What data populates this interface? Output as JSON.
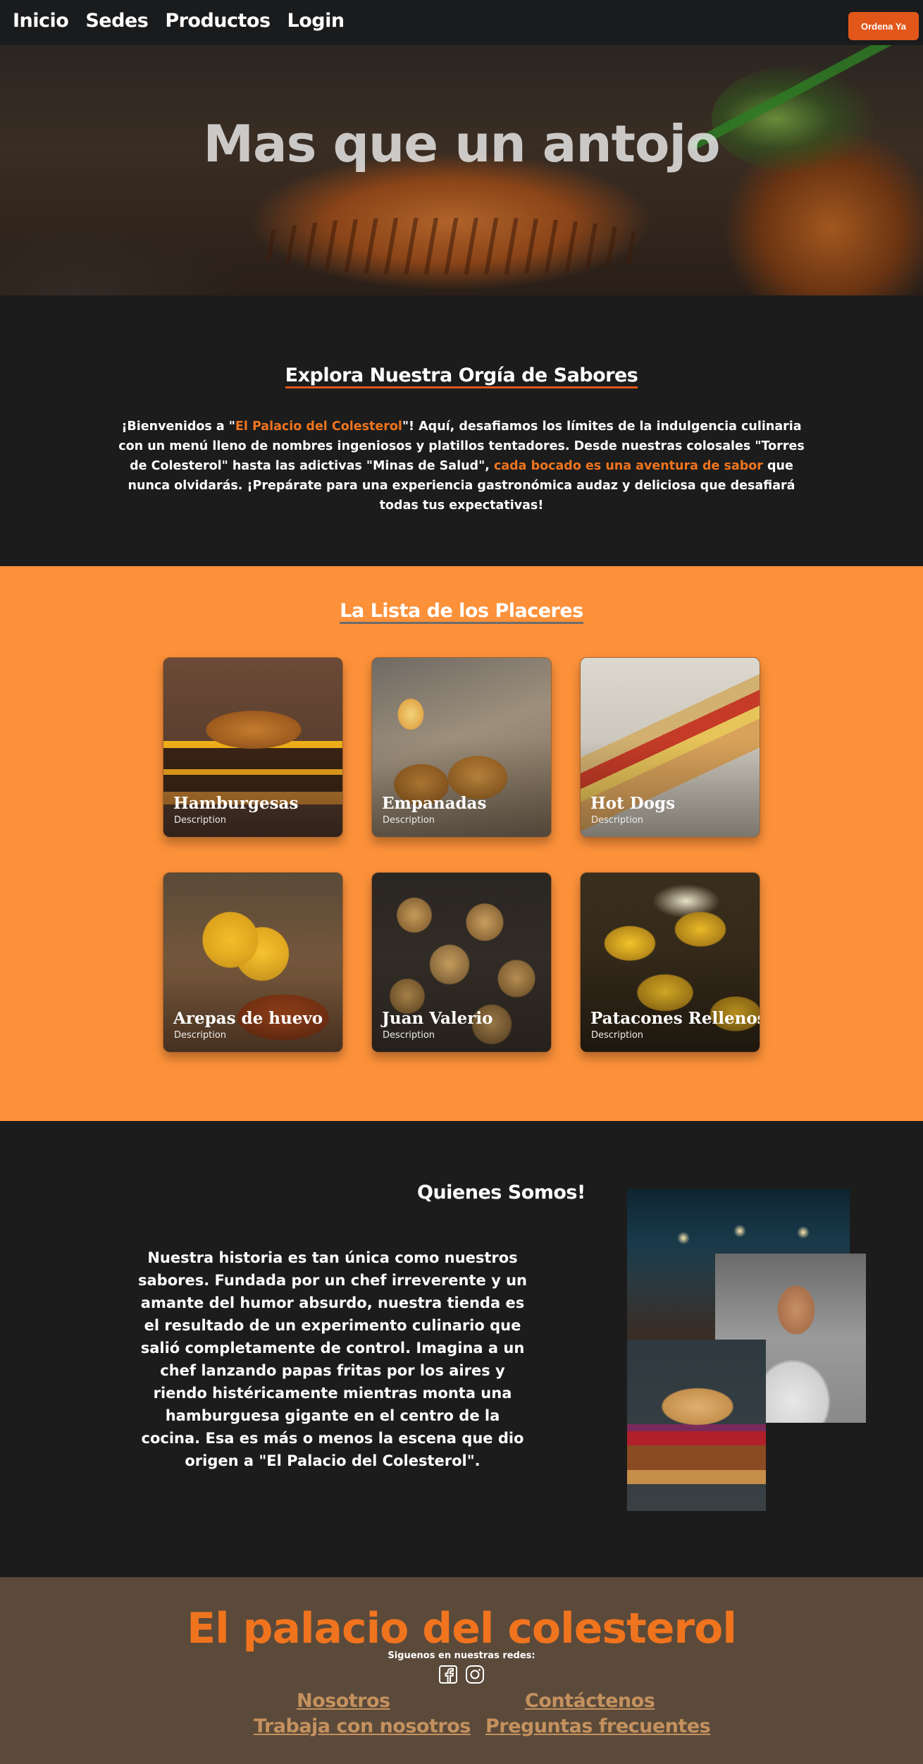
{
  "nav": {
    "links": [
      "Inicio",
      "Sedes",
      "Productos",
      "Login"
    ],
    "order_button": "Ordena Ya"
  },
  "hero": {
    "title": "Mas que un antojo"
  },
  "intro": {
    "title": "Explora Nuestra Orgía de Sabores",
    "text_1": "¡Bienvenidos a \"",
    "highlight_1": "El Palacio del Colesterol",
    "text_2": "\"! Aquí, desafiamos los límites de la indulgencia culinaria con un menú lleno de nombres ingeniosos y platillos tentadores. Desde nuestras colosales \"Torres de Colesterol\" hasta las adictivas \"Minas de Salud\", ",
    "highlight_2": "cada bocado es una aventura de sabor",
    "text_3": " que nunca olvidarás. ¡Prepárate para una experiencia gastronómica audaz y deliciosa que desafiará todas tus expectativas!"
  },
  "menu": {
    "title": "La Lista de los Placeres",
    "items": [
      {
        "name": "Hamburgesas",
        "description": "Description"
      },
      {
        "name": "Empanadas",
        "description": "Description"
      },
      {
        "name": "Hot Dogs",
        "description": "Description"
      },
      {
        "name": "Arepas de huevo",
        "description": "Description"
      },
      {
        "name": "Juan Valerio",
        "description": "Description"
      },
      {
        "name": "Patacones Rellenos",
        "description": "Description"
      }
    ]
  },
  "about": {
    "title": "Quienes Somos!",
    "text": "Nuestra historia es tan única como nuestros sabores. Fundada por un chef irreverente y un amante del humor absurdo, nuestra tienda es el resultado de un experimento culinario que salió completamente de control. Imagina a un chef lanzando papas fritas por los aires y riendo histéricamente mientras monta una hamburguesa gigante en el centro de la cocina. Esa es más o menos la escena que dio origen a \"El Palacio del Colesterol\"."
  },
  "footer": {
    "brand": "El palacio del colesterol",
    "follow": "Siguenos en nuestras redes:",
    "social_icons": [
      "facebook-icon",
      "instagram-icon"
    ],
    "links": [
      "Nosotros",
      "Contáctenos",
      "Trabaja con nosotros",
      "Preguntas frecuentes"
    ]
  },
  "colors": {
    "accent": "#f0741e",
    "button": "#e2561a",
    "menu_background": "#fc913a",
    "dark_background": "#1c1c1c",
    "footer_background": "#5b4a3a",
    "footer_link": "#c4915e"
  }
}
